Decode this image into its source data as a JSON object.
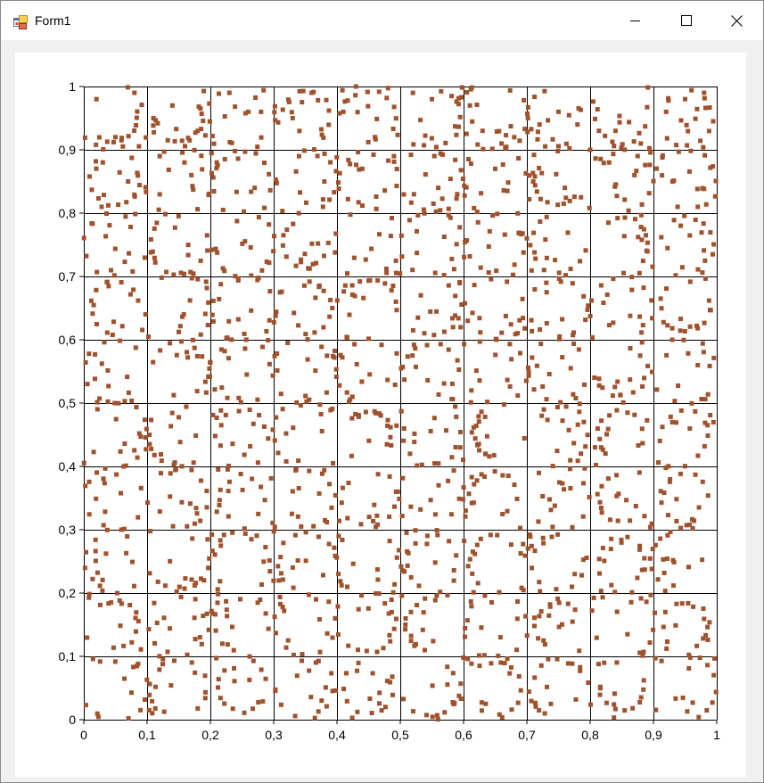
{
  "window": {
    "title": "Form1",
    "icons": {
      "app": "form-app-icon",
      "minimize": "minimize-icon",
      "maximize": "maximize-icon",
      "close": "close-icon"
    }
  },
  "chart_data": {
    "type": "scatter",
    "title": "",
    "xlabel": "",
    "ylabel": "",
    "xlim": [
      0,
      1
    ],
    "ylim": [
      0,
      1
    ],
    "grid": true,
    "marker_color": "#a0522d",
    "x_tick_labels": [
      "0",
      "0,1",
      "0,2",
      "0,3",
      "0,4",
      "0,5",
      "0,6",
      "0,7",
      "0,8",
      "0,9",
      "1"
    ],
    "y_tick_labels": [
      "0",
      "0,1",
      "0,2",
      "0,3",
      "0,4",
      "0,5",
      "0,6",
      "0,7",
      "0,8",
      "0,9",
      "1"
    ],
    "points_per_cell": 18,
    "series": [
      {
        "x": [
          0.02,
          0.05,
          0.08,
          0.11,
          0.14,
          0.18,
          0.23,
          0.26,
          0.28,
          0.33,
          0.36,
          0.41,
          0.43,
          0.46,
          0.52,
          0.55,
          0.61,
          0.63,
          0.66,
          0.68,
          0.72,
          0.75,
          0.78,
          0.8,
          0.84,
          0.88,
          0.92,
          0.95,
          0.98,
          0.03,
          0.07,
          0.12,
          0.17,
          0.21,
          0.27,
          0.34,
          0.38,
          0.44,
          0.49,
          0.56,
          0.59,
          0.65,
          0.71,
          0.76,
          0.83,
          0.87,
          0.93,
          0.97
        ],
        "y": [
          0.98,
          0.92,
          0.99,
          0.95,
          0.97,
          0.93,
          0.99,
          0.96,
          0.96,
          0.95,
          0.99,
          0.96,
          1.0,
          0.92,
          0.99,
          0.98,
          0.97,
          0.93,
          0.91,
          0.92,
          0.94,
          0.96,
          0.94,
          0.9,
          0.93,
          0.91,
          0.96,
          0.98,
          0.99,
          0.88,
          0.85,
          0.89,
          0.86,
          0.88,
          0.84,
          0.89,
          0.85,
          0.87,
          0.89,
          0.84,
          0.83,
          0.87,
          0.85,
          0.84,
          0.88,
          0.86,
          0.85,
          0.81
        ]
      }
    ]
  }
}
